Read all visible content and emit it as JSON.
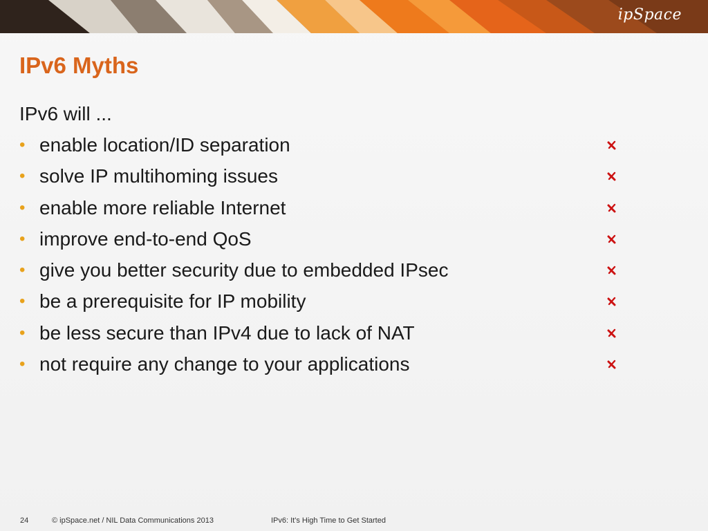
{
  "header": {
    "logo_text": "ipSpace"
  },
  "slide": {
    "title": "IPv6 Myths",
    "intro": "IPv6 will ...",
    "bullet_glyph": "•",
    "bullets": [
      {
        "text": "enable location/ID separation",
        "mark": "cross"
      },
      {
        "text": "solve IP multihoming issues",
        "mark": "cross"
      },
      {
        "text": "enable more reliable Internet",
        "mark": "cross"
      },
      {
        "text": "improve end-to-end QoS",
        "mark": "cross"
      },
      {
        "text": "give you better security due to embedded IPsec",
        "mark": "cross"
      },
      {
        "text": "be a prerequisite for IP mobility",
        "mark": "cross"
      },
      {
        "text": "be less secure than IPv4 due to lack of NAT",
        "mark": "cross"
      },
      {
        "text": "not require any change to your applications",
        "mark": "cross"
      }
    ]
  },
  "footer": {
    "page_number": "24",
    "copyright": "© ipSpace.net / NIL Data Communications 2013",
    "presentation_title": "IPv6: It's High Time to Get Started"
  },
  "colors": {
    "title": "#d9651c",
    "bullet": "#e8a21c",
    "cross": "#cc1111",
    "text": "#1a1a1a",
    "background": "#f4f4f4"
  }
}
